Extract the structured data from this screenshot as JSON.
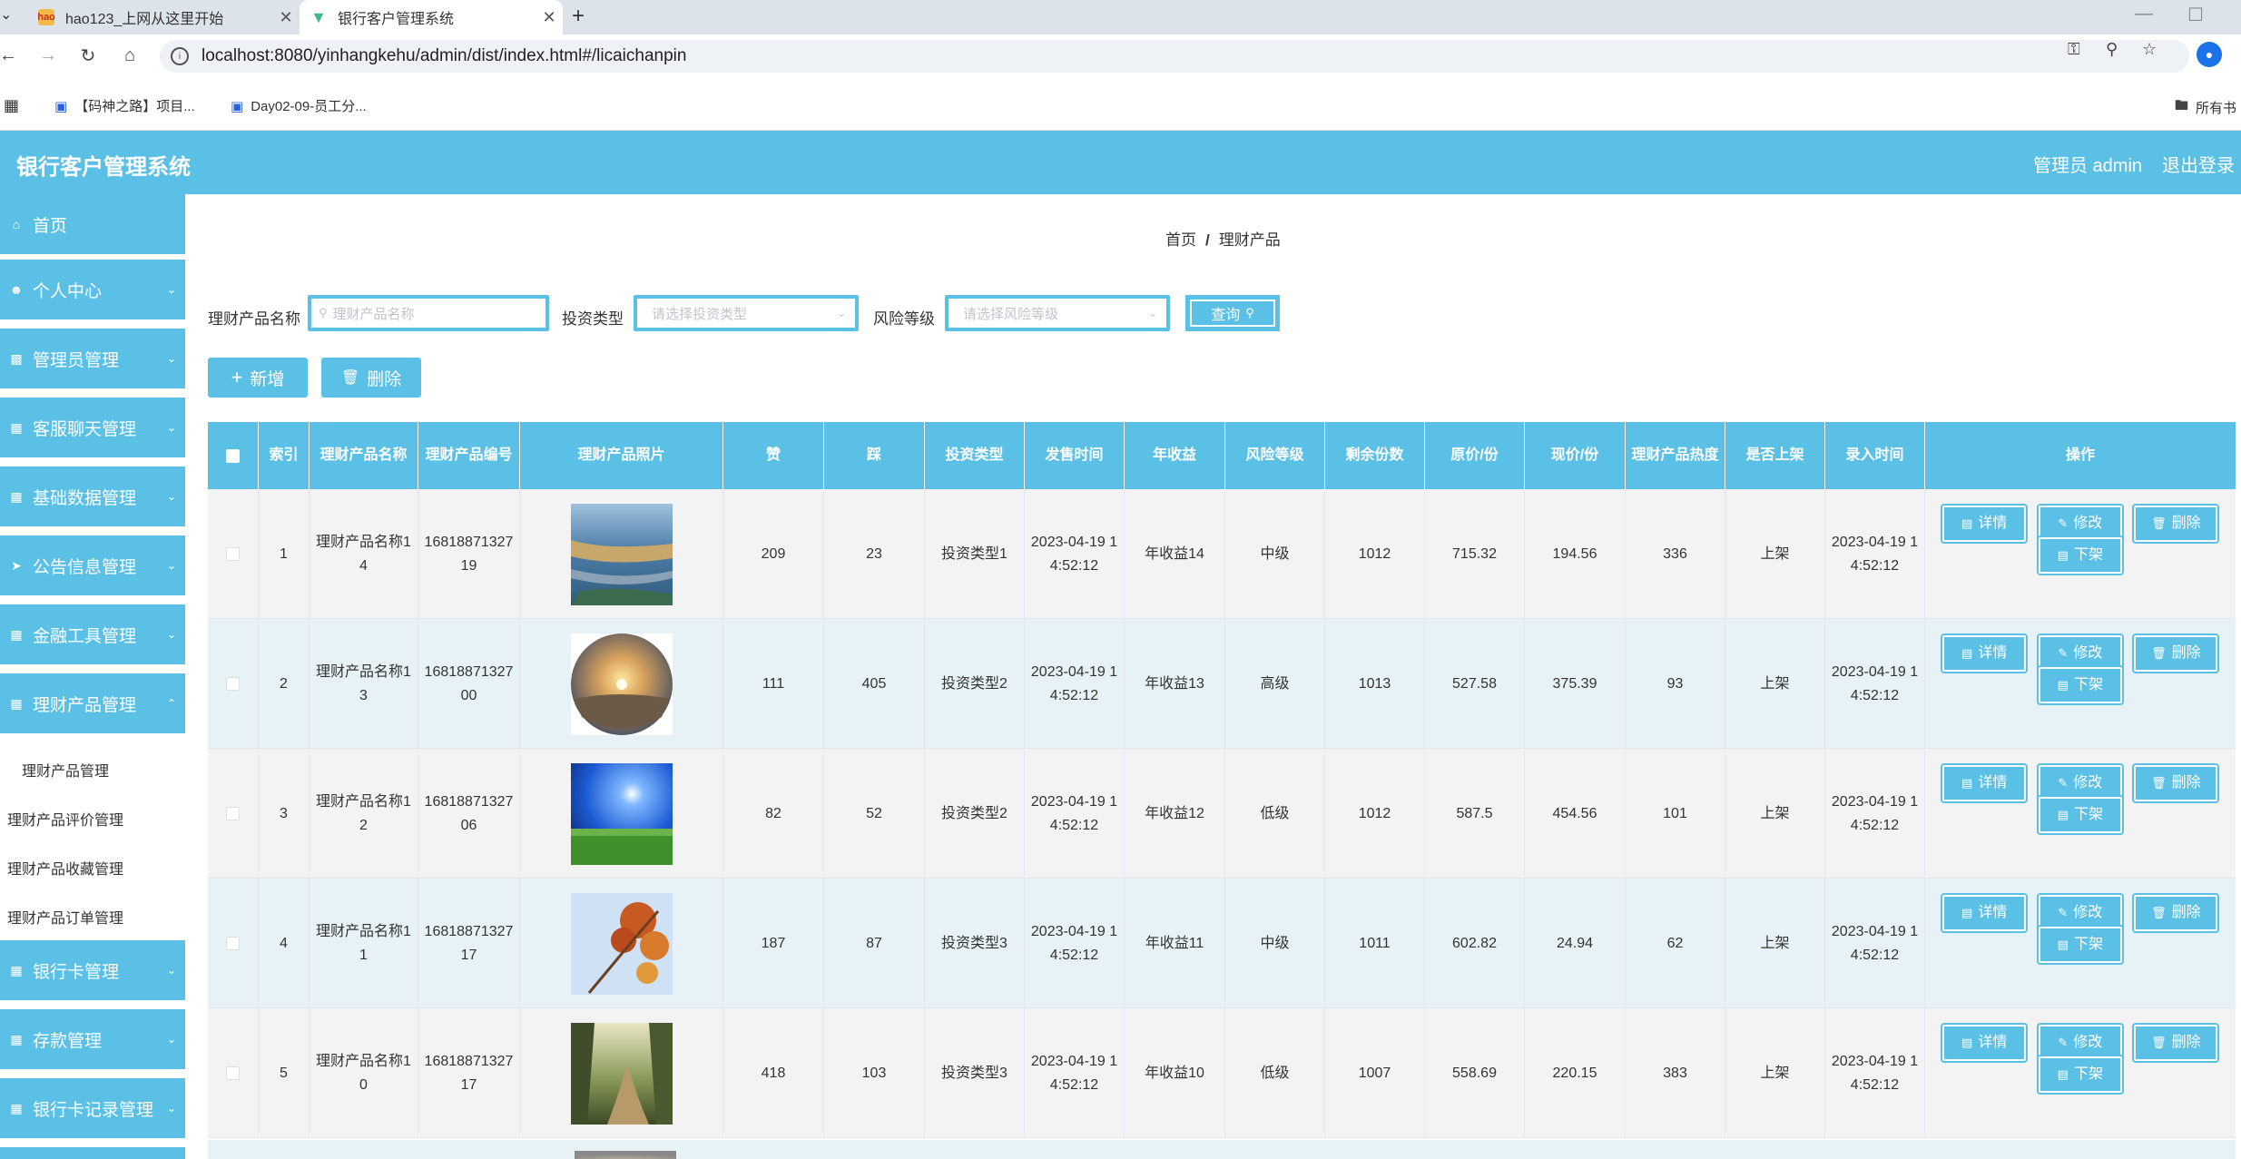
{
  "browser": {
    "tabs": [
      {
        "title": "hao123_上网从这里开始",
        "favicon": "hao123-icon",
        "active": false
      },
      {
        "title": "银行客户管理系统",
        "favicon": "vue-icon",
        "active": true
      }
    ],
    "new_tab": "+",
    "url": "localhost:8080/yinhangkehu/admin/dist/index.html#/licaichanpin",
    "bookmarks": [
      "【码神之路】项目...",
      "Day02-09-员工分..."
    ],
    "all_bookmarks": "所有书"
  },
  "header": {
    "title": "银行客户管理系统",
    "user": "管理员 admin",
    "logout": "退出登录",
    "accent": "#5bc0e6"
  },
  "sidebar": {
    "items": [
      {
        "label": "首页",
        "icon": "home-icon"
      },
      {
        "label": "个人中心",
        "icon": "user-icon"
      },
      {
        "label": "管理员管理",
        "icon": "chart-icon"
      },
      {
        "label": "客服聊天管理",
        "icon": "grid-icon"
      },
      {
        "label": "基础数据管理",
        "icon": "grid-icon"
      },
      {
        "label": "公告信息管理",
        "icon": "send-icon"
      },
      {
        "label": "金融工具管理",
        "icon": "grid-icon"
      },
      {
        "label": "理财产品管理",
        "icon": "grid-icon"
      },
      {
        "label": "银行卡管理",
        "icon": "grid-icon"
      },
      {
        "label": "存款管理",
        "icon": "grid-icon"
      },
      {
        "label": "银行卡记录管理",
        "icon": "grid-icon"
      }
    ],
    "sub_items": [
      "理财产品管理",
      "理财产品评价管理",
      "理财产品收藏管理",
      "理财产品订单管理"
    ]
  },
  "breadcrumb": {
    "home": "首页",
    "sep": "/",
    "current": "理财产品"
  },
  "search": {
    "name_label": "理财产品名称",
    "name_placeholder": "理财产品名称",
    "type_label": "投资类型",
    "type_placeholder": "请选择投资类型",
    "risk_label": "风险等级",
    "risk_placeholder": "请选择风险等级",
    "query": "查询"
  },
  "actions": {
    "add": "新增",
    "delete": "删除"
  },
  "table": {
    "columns": [
      "索引",
      "理财产品名称",
      "理财产品编号",
      "理财产品照片",
      "赞",
      "踩",
      "投资类型",
      "发售时间",
      "年收益",
      "风险等级",
      "剩余份数",
      "原价/份",
      "现价/份",
      "理财产品热度",
      "是否上架",
      "录入时间",
      "操作"
    ],
    "row_buttons": {
      "detail": "详情",
      "edit": "修改",
      "delete": "删除",
      "offline": "下架"
    },
    "rows": [
      {
        "index": "1",
        "name": "理财产品名称14",
        "code": "1681887132719",
        "photo": "wetland-landscape",
        "likes": "209",
        "dislikes": "23",
        "type": "投资类型1",
        "sale_time": "2023-04-19 14:52:12",
        "yield": "年收益14",
        "risk": "中级",
        "remaining": "1012",
        "orig_price": "715.32",
        "cur_price": "194.56",
        "heat": "336",
        "on_shelf": "上架",
        "entry_time": "2023-04-19 14:52:12"
      },
      {
        "index": "2",
        "name": "理财产品名称13",
        "code": "1681887132700",
        "photo": "sunset-circle",
        "likes": "111",
        "dislikes": "405",
        "type": "投资类型2",
        "sale_time": "2023-04-19 14:52:12",
        "yield": "年收益13",
        "risk": "高级",
        "remaining": "1013",
        "orig_price": "527.58",
        "cur_price": "375.39",
        "heat": "93",
        "on_shelf": "上架",
        "entry_time": "2023-04-19 14:52:12"
      },
      {
        "index": "3",
        "name": "理财产品名称12",
        "code": "1681887132706",
        "photo": "sun-over-field",
        "likes": "82",
        "dislikes": "52",
        "type": "投资类型2",
        "sale_time": "2023-04-19 14:52:12",
        "yield": "年收益12",
        "risk": "低级",
        "remaining": "1012",
        "orig_price": "587.5",
        "cur_price": "454.56",
        "heat": "101",
        "on_shelf": "上架",
        "entry_time": "2023-04-19 14:52:12"
      },
      {
        "index": "4",
        "name": "理财产品名称11",
        "code": "1681887132717",
        "photo": "autumn-leaves",
        "likes": "187",
        "dislikes": "87",
        "type": "投资类型3",
        "sale_time": "2023-04-19 14:52:12",
        "yield": "年收益11",
        "risk": "中级",
        "remaining": "1011",
        "orig_price": "602.82",
        "cur_price": "24.94",
        "heat": "62",
        "on_shelf": "上架",
        "entry_time": "2023-04-19 14:52:12"
      },
      {
        "index": "5",
        "name": "理财产品名称10",
        "code": "1681887132717",
        "photo": "forest-path",
        "likes": "418",
        "dislikes": "103",
        "type": "投资类型3",
        "sale_time": "2023-04-19 14:52:12",
        "yield": "年收益10",
        "risk": "低级",
        "remaining": "1007",
        "orig_price": "558.69",
        "cur_price": "220.15",
        "heat": "383",
        "on_shelf": "上架",
        "entry_time": "2023-04-19 14:52:12"
      }
    ]
  }
}
